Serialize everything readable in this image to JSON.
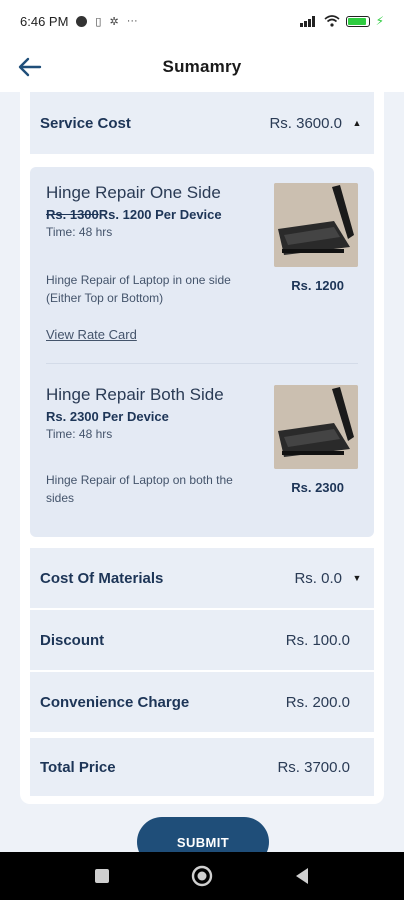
{
  "status_bar": {
    "time": "6:46 PM",
    "icons": [
      "messenger-icon",
      "sim-icon",
      "gear-icon",
      "more-icon",
      "signal-icon",
      "wifi-icon",
      "battery-icon"
    ]
  },
  "header": {
    "title": "Sumamry",
    "back_icon": "arrow-left-icon"
  },
  "service_cost": {
    "label": "Service Cost",
    "value": "Rs. 3600.0",
    "expanded": true
  },
  "items": [
    {
      "title": "Hinge Repair One Side",
      "old_price": "Rs. 1300",
      "price": "Rs. 1200 Per Device",
      "time": "Time: 48 hrs",
      "description": "Hinge Repair of Laptop in one side (Either Top or Bottom)",
      "total": "Rs. 1200",
      "link": "View Rate Card"
    },
    {
      "title": "Hinge Repair Both Side",
      "price": "Rs. 2300 Per Device",
      "time": "Time: 48 hrs",
      "description": "Hinge Repair of Laptop on both the sides",
      "total": "Rs. 2300"
    }
  ],
  "materials": {
    "label": "Cost Of Materials",
    "value": "Rs. 0.0",
    "expanded": false
  },
  "discount": {
    "label": "Discount",
    "value": "Rs. 100.0"
  },
  "convenience": {
    "label": "Convenience Charge",
    "value": "Rs. 200.0"
  },
  "total": {
    "label": "Total Price",
    "value": "Rs. 3700.0"
  },
  "submit": {
    "label": "SUBMIT"
  },
  "nav": {
    "icons": [
      "recents-square-icon",
      "home-circle-icon",
      "back-triangle-icon"
    ]
  },
  "colors": {
    "accent": "#1f4e79",
    "background": "#eef2f8",
    "row_bg": "#e9eef6"
  }
}
